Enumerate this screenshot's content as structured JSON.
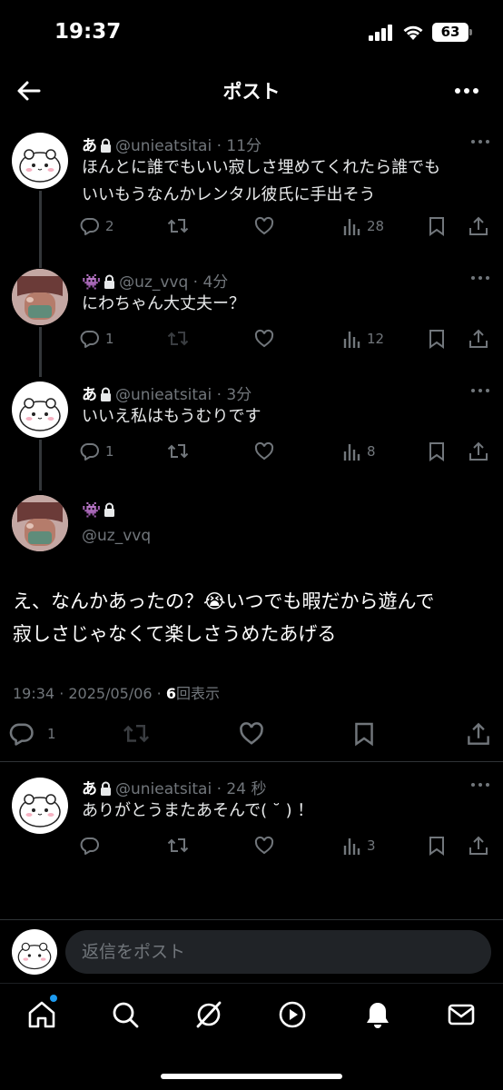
{
  "status_bar": {
    "time": "19:37",
    "battery": "63"
  },
  "header": {
    "title": "ポスト"
  },
  "posts": [
    {
      "name": "あ",
      "meta": "@unieatsitai · 11分",
      "lines": [
        "ほんとに誰でもいい寂しさ埋めてくれたら誰でも",
        "いいもうなんかレンタル彼氏に手出そう"
      ],
      "replies": "2",
      "views": "28"
    },
    {
      "name": "👾",
      "meta": "@uz_vvq · 4分",
      "lines": [
        "にわちゃん大丈夫ー？"
      ],
      "replies": "1",
      "views": "12"
    },
    {
      "name": "あ",
      "meta": "@unieatsitai · 3分",
      "lines": [
        "いいえ私はもうむりです"
      ],
      "replies": "1",
      "views": "8"
    }
  ],
  "focus_post": {
    "name": "👾",
    "handle": "@uz_vvq",
    "lines": [
      "え、なんかあったの？😭いつでも暇だから遊んで",
      "寂しさじゃなくて楽しさうめたあげる"
    ],
    "timestamp": "19:34 · 2025/05/06 · ",
    "views_count": "6",
    "views_label": "回表示",
    "replies": "1"
  },
  "reply_post": {
    "name": "あ",
    "meta": "@unieatsitai · 24 秒",
    "lines": [
      "ありがとうまたあそんで( ˘ ) ！"
    ],
    "views": "3"
  },
  "reply_bar": {
    "placeholder": "返信をポスト"
  },
  "tabs": [
    "home-icon",
    "search-icon",
    "grok-icon",
    "video-icon",
    "bell-icon",
    "mail-icon"
  ],
  "colors": {
    "accent": "#1d9bf0",
    "muted": "#71767b",
    "background": "#000000"
  }
}
